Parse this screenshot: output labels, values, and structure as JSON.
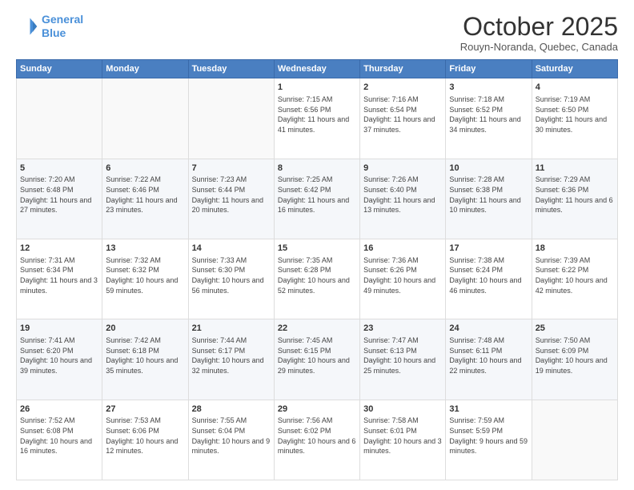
{
  "header": {
    "logo_line1": "General",
    "logo_line2": "Blue",
    "month": "October 2025",
    "location": "Rouyn-Noranda, Quebec, Canada"
  },
  "weekdays": [
    "Sunday",
    "Monday",
    "Tuesday",
    "Wednesday",
    "Thursday",
    "Friday",
    "Saturday"
  ],
  "weeks": [
    [
      {
        "day": "",
        "sunrise": "",
        "sunset": "",
        "daylight": ""
      },
      {
        "day": "",
        "sunrise": "",
        "sunset": "",
        "daylight": ""
      },
      {
        "day": "",
        "sunrise": "",
        "sunset": "",
        "daylight": ""
      },
      {
        "day": "1",
        "sunrise": "Sunrise: 7:15 AM",
        "sunset": "Sunset: 6:56 PM",
        "daylight": "Daylight: 11 hours and 41 minutes."
      },
      {
        "day": "2",
        "sunrise": "Sunrise: 7:16 AM",
        "sunset": "Sunset: 6:54 PM",
        "daylight": "Daylight: 11 hours and 37 minutes."
      },
      {
        "day": "3",
        "sunrise": "Sunrise: 7:18 AM",
        "sunset": "Sunset: 6:52 PM",
        "daylight": "Daylight: 11 hours and 34 minutes."
      },
      {
        "day": "4",
        "sunrise": "Sunrise: 7:19 AM",
        "sunset": "Sunset: 6:50 PM",
        "daylight": "Daylight: 11 hours and 30 minutes."
      }
    ],
    [
      {
        "day": "5",
        "sunrise": "Sunrise: 7:20 AM",
        "sunset": "Sunset: 6:48 PM",
        "daylight": "Daylight: 11 hours and 27 minutes."
      },
      {
        "day": "6",
        "sunrise": "Sunrise: 7:22 AM",
        "sunset": "Sunset: 6:46 PM",
        "daylight": "Daylight: 11 hours and 23 minutes."
      },
      {
        "day": "7",
        "sunrise": "Sunrise: 7:23 AM",
        "sunset": "Sunset: 6:44 PM",
        "daylight": "Daylight: 11 hours and 20 minutes."
      },
      {
        "day": "8",
        "sunrise": "Sunrise: 7:25 AM",
        "sunset": "Sunset: 6:42 PM",
        "daylight": "Daylight: 11 hours and 16 minutes."
      },
      {
        "day": "9",
        "sunrise": "Sunrise: 7:26 AM",
        "sunset": "Sunset: 6:40 PM",
        "daylight": "Daylight: 11 hours and 13 minutes."
      },
      {
        "day": "10",
        "sunrise": "Sunrise: 7:28 AM",
        "sunset": "Sunset: 6:38 PM",
        "daylight": "Daylight: 11 hours and 10 minutes."
      },
      {
        "day": "11",
        "sunrise": "Sunrise: 7:29 AM",
        "sunset": "Sunset: 6:36 PM",
        "daylight": "Daylight: 11 hours and 6 minutes."
      }
    ],
    [
      {
        "day": "12",
        "sunrise": "Sunrise: 7:31 AM",
        "sunset": "Sunset: 6:34 PM",
        "daylight": "Daylight: 11 hours and 3 minutes."
      },
      {
        "day": "13",
        "sunrise": "Sunrise: 7:32 AM",
        "sunset": "Sunset: 6:32 PM",
        "daylight": "Daylight: 10 hours and 59 minutes."
      },
      {
        "day": "14",
        "sunrise": "Sunrise: 7:33 AM",
        "sunset": "Sunset: 6:30 PM",
        "daylight": "Daylight: 10 hours and 56 minutes."
      },
      {
        "day": "15",
        "sunrise": "Sunrise: 7:35 AM",
        "sunset": "Sunset: 6:28 PM",
        "daylight": "Daylight: 10 hours and 52 minutes."
      },
      {
        "day": "16",
        "sunrise": "Sunrise: 7:36 AM",
        "sunset": "Sunset: 6:26 PM",
        "daylight": "Daylight: 10 hours and 49 minutes."
      },
      {
        "day": "17",
        "sunrise": "Sunrise: 7:38 AM",
        "sunset": "Sunset: 6:24 PM",
        "daylight": "Daylight: 10 hours and 46 minutes."
      },
      {
        "day": "18",
        "sunrise": "Sunrise: 7:39 AM",
        "sunset": "Sunset: 6:22 PM",
        "daylight": "Daylight: 10 hours and 42 minutes."
      }
    ],
    [
      {
        "day": "19",
        "sunrise": "Sunrise: 7:41 AM",
        "sunset": "Sunset: 6:20 PM",
        "daylight": "Daylight: 10 hours and 39 minutes."
      },
      {
        "day": "20",
        "sunrise": "Sunrise: 7:42 AM",
        "sunset": "Sunset: 6:18 PM",
        "daylight": "Daylight: 10 hours and 35 minutes."
      },
      {
        "day": "21",
        "sunrise": "Sunrise: 7:44 AM",
        "sunset": "Sunset: 6:17 PM",
        "daylight": "Daylight: 10 hours and 32 minutes."
      },
      {
        "day": "22",
        "sunrise": "Sunrise: 7:45 AM",
        "sunset": "Sunset: 6:15 PM",
        "daylight": "Daylight: 10 hours and 29 minutes."
      },
      {
        "day": "23",
        "sunrise": "Sunrise: 7:47 AM",
        "sunset": "Sunset: 6:13 PM",
        "daylight": "Daylight: 10 hours and 25 minutes."
      },
      {
        "day": "24",
        "sunrise": "Sunrise: 7:48 AM",
        "sunset": "Sunset: 6:11 PM",
        "daylight": "Daylight: 10 hours and 22 minutes."
      },
      {
        "day": "25",
        "sunrise": "Sunrise: 7:50 AM",
        "sunset": "Sunset: 6:09 PM",
        "daylight": "Daylight: 10 hours and 19 minutes."
      }
    ],
    [
      {
        "day": "26",
        "sunrise": "Sunrise: 7:52 AM",
        "sunset": "Sunset: 6:08 PM",
        "daylight": "Daylight: 10 hours and 16 minutes."
      },
      {
        "day": "27",
        "sunrise": "Sunrise: 7:53 AM",
        "sunset": "Sunset: 6:06 PM",
        "daylight": "Daylight: 10 hours and 12 minutes."
      },
      {
        "day": "28",
        "sunrise": "Sunrise: 7:55 AM",
        "sunset": "Sunset: 6:04 PM",
        "daylight": "Daylight: 10 hours and 9 minutes."
      },
      {
        "day": "29",
        "sunrise": "Sunrise: 7:56 AM",
        "sunset": "Sunset: 6:02 PM",
        "daylight": "Daylight: 10 hours and 6 minutes."
      },
      {
        "day": "30",
        "sunrise": "Sunrise: 7:58 AM",
        "sunset": "Sunset: 6:01 PM",
        "daylight": "Daylight: 10 hours and 3 minutes."
      },
      {
        "day": "31",
        "sunrise": "Sunrise: 7:59 AM",
        "sunset": "Sunset: 5:59 PM",
        "daylight": "Daylight: 9 hours and 59 minutes."
      },
      {
        "day": "",
        "sunrise": "",
        "sunset": "",
        "daylight": ""
      }
    ]
  ]
}
